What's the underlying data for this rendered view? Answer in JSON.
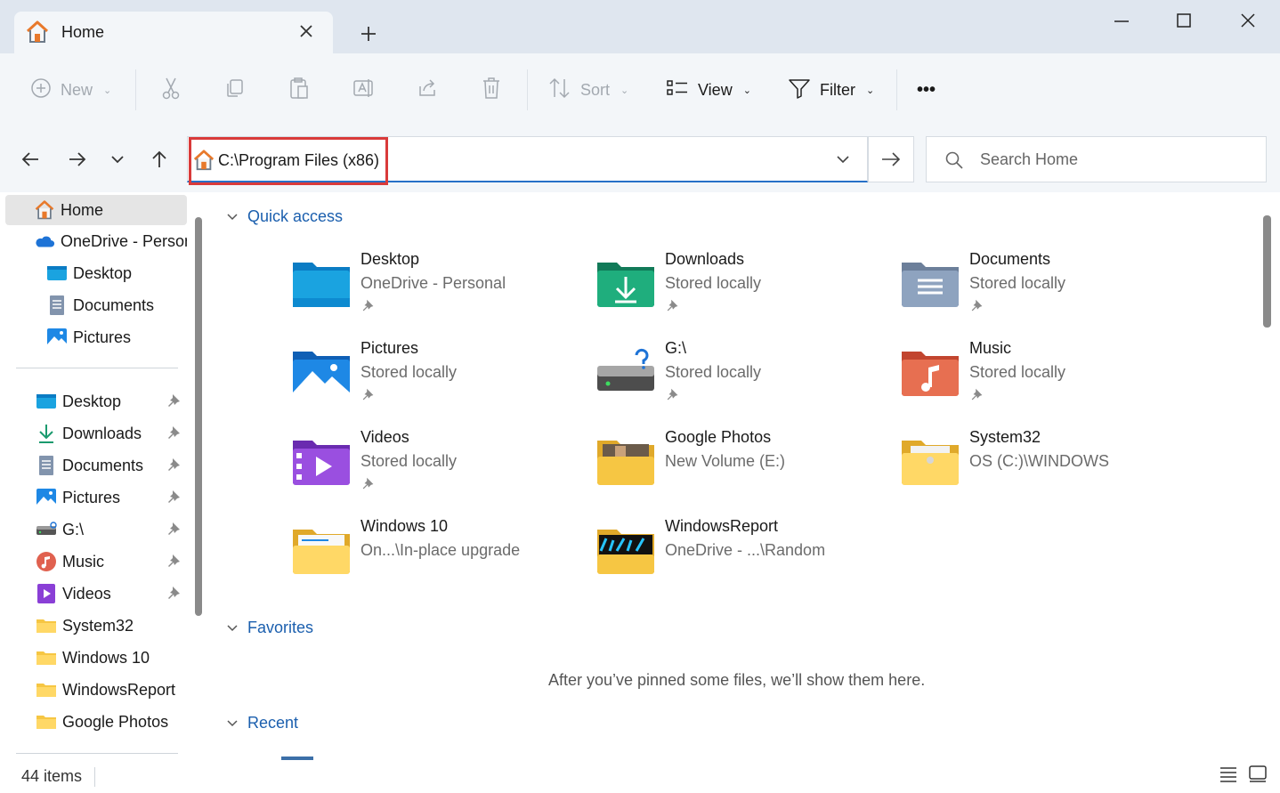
{
  "tab": {
    "title": "Home"
  },
  "toolbar": {
    "new_label": "New",
    "sort_label": "Sort",
    "view_label": "View",
    "filter_label": "Filter",
    "more_label": "•••"
  },
  "address": {
    "path": "C:\\Program Files (x86)"
  },
  "search": {
    "placeholder": "Search Home"
  },
  "sidebar": {
    "items": [
      {
        "label": "Home"
      },
      {
        "label": "OneDrive - Personal"
      },
      {
        "label": "Desktop"
      },
      {
        "label": "Documents"
      },
      {
        "label": "Pictures"
      }
    ],
    "quick": [
      {
        "label": "Desktop"
      },
      {
        "label": "Downloads"
      },
      {
        "label": "Documents"
      },
      {
        "label": "Pictures"
      },
      {
        "label": "G:\\"
      },
      {
        "label": "Music"
      },
      {
        "label": "Videos"
      },
      {
        "label": "System32"
      },
      {
        "label": "Windows 10"
      },
      {
        "label": "WindowsReport"
      },
      {
        "label": "Google Photos"
      }
    ]
  },
  "sections": {
    "quick_access": "Quick access",
    "favorites": "Favorites",
    "recent": "Recent",
    "favorites_empty": "After you’ve pinned some files, we’ll show them here."
  },
  "quick_access": [
    {
      "name": "Desktop",
      "sub": "OneDrive - Personal",
      "icon": "desktop-folder-icon"
    },
    {
      "name": "Downloads",
      "sub": "Stored locally",
      "icon": "downloads-folder-icon"
    },
    {
      "name": "Documents",
      "sub": "Stored locally",
      "icon": "documents-folder-icon"
    },
    {
      "name": "Pictures",
      "sub": "Stored locally",
      "icon": "pictures-folder-icon"
    },
    {
      "name": "G:\\",
      "sub": "Stored locally",
      "icon": "drive-icon"
    },
    {
      "name": "Music",
      "sub": "Stored locally",
      "icon": "music-folder-icon"
    },
    {
      "name": "Videos",
      "sub": "Stored locally",
      "icon": "videos-folder-icon"
    },
    {
      "name": "Google Photos",
      "sub": "New Volume (E:)",
      "icon": "photo-folder-icon"
    },
    {
      "name": "System32",
      "sub": "OS (C:)\\WINDOWS",
      "icon": "system-folder-icon"
    },
    {
      "name": "Windows 10",
      "sub": "On...\\In-place upgrade",
      "icon": "folder-icon"
    },
    {
      "name": "WindowsReport",
      "sub": "OneDrive - ...\\Random",
      "icon": "folder-icon"
    }
  ],
  "status": {
    "items": "44 items"
  },
  "colors": {
    "accent": "#2770c7",
    "highlight": "#d93a3a",
    "folder": "#f6c643"
  }
}
